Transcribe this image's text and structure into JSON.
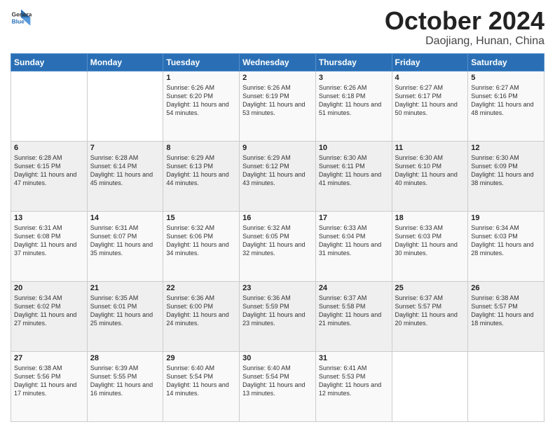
{
  "logo": {
    "general": "General",
    "blue": "Blue"
  },
  "header": {
    "title": "October 2024",
    "subtitle": "Daojiang, Hunan, China"
  },
  "days_of_week": [
    "Sunday",
    "Monday",
    "Tuesday",
    "Wednesday",
    "Thursday",
    "Friday",
    "Saturday"
  ],
  "weeks": [
    [
      {
        "day": "",
        "detail": ""
      },
      {
        "day": "",
        "detail": ""
      },
      {
        "day": "1",
        "detail": "Sunrise: 6:26 AM\nSunset: 6:20 PM\nDaylight: 11 hours and 54 minutes."
      },
      {
        "day": "2",
        "detail": "Sunrise: 6:26 AM\nSunset: 6:19 PM\nDaylight: 11 hours and 53 minutes."
      },
      {
        "day": "3",
        "detail": "Sunrise: 6:26 AM\nSunset: 6:18 PM\nDaylight: 11 hours and 51 minutes."
      },
      {
        "day": "4",
        "detail": "Sunrise: 6:27 AM\nSunset: 6:17 PM\nDaylight: 11 hours and 50 minutes."
      },
      {
        "day": "5",
        "detail": "Sunrise: 6:27 AM\nSunset: 6:16 PM\nDaylight: 11 hours and 48 minutes."
      }
    ],
    [
      {
        "day": "6",
        "detail": "Sunrise: 6:28 AM\nSunset: 6:15 PM\nDaylight: 11 hours and 47 minutes."
      },
      {
        "day": "7",
        "detail": "Sunrise: 6:28 AM\nSunset: 6:14 PM\nDaylight: 11 hours and 45 minutes."
      },
      {
        "day": "8",
        "detail": "Sunrise: 6:29 AM\nSunset: 6:13 PM\nDaylight: 11 hours and 44 minutes."
      },
      {
        "day": "9",
        "detail": "Sunrise: 6:29 AM\nSunset: 6:12 PM\nDaylight: 11 hours and 43 minutes."
      },
      {
        "day": "10",
        "detail": "Sunrise: 6:30 AM\nSunset: 6:11 PM\nDaylight: 11 hours and 41 minutes."
      },
      {
        "day": "11",
        "detail": "Sunrise: 6:30 AM\nSunset: 6:10 PM\nDaylight: 11 hours and 40 minutes."
      },
      {
        "day": "12",
        "detail": "Sunrise: 6:30 AM\nSunset: 6:09 PM\nDaylight: 11 hours and 38 minutes."
      }
    ],
    [
      {
        "day": "13",
        "detail": "Sunrise: 6:31 AM\nSunset: 6:08 PM\nDaylight: 11 hours and 37 minutes."
      },
      {
        "day": "14",
        "detail": "Sunrise: 6:31 AM\nSunset: 6:07 PM\nDaylight: 11 hours and 35 minutes."
      },
      {
        "day": "15",
        "detail": "Sunrise: 6:32 AM\nSunset: 6:06 PM\nDaylight: 11 hours and 34 minutes."
      },
      {
        "day": "16",
        "detail": "Sunrise: 6:32 AM\nSunset: 6:05 PM\nDaylight: 11 hours and 32 minutes."
      },
      {
        "day": "17",
        "detail": "Sunrise: 6:33 AM\nSunset: 6:04 PM\nDaylight: 11 hours and 31 minutes."
      },
      {
        "day": "18",
        "detail": "Sunrise: 6:33 AM\nSunset: 6:03 PM\nDaylight: 11 hours and 30 minutes."
      },
      {
        "day": "19",
        "detail": "Sunrise: 6:34 AM\nSunset: 6:03 PM\nDaylight: 11 hours and 28 minutes."
      }
    ],
    [
      {
        "day": "20",
        "detail": "Sunrise: 6:34 AM\nSunset: 6:02 PM\nDaylight: 11 hours and 27 minutes."
      },
      {
        "day": "21",
        "detail": "Sunrise: 6:35 AM\nSunset: 6:01 PM\nDaylight: 11 hours and 25 minutes."
      },
      {
        "day": "22",
        "detail": "Sunrise: 6:36 AM\nSunset: 6:00 PM\nDaylight: 11 hours and 24 minutes."
      },
      {
        "day": "23",
        "detail": "Sunrise: 6:36 AM\nSunset: 5:59 PM\nDaylight: 11 hours and 23 minutes."
      },
      {
        "day": "24",
        "detail": "Sunrise: 6:37 AM\nSunset: 5:58 PM\nDaylight: 11 hours and 21 minutes."
      },
      {
        "day": "25",
        "detail": "Sunrise: 6:37 AM\nSunset: 5:57 PM\nDaylight: 11 hours and 20 minutes."
      },
      {
        "day": "26",
        "detail": "Sunrise: 6:38 AM\nSunset: 5:57 PM\nDaylight: 11 hours and 18 minutes."
      }
    ],
    [
      {
        "day": "27",
        "detail": "Sunrise: 6:38 AM\nSunset: 5:56 PM\nDaylight: 11 hours and 17 minutes."
      },
      {
        "day": "28",
        "detail": "Sunrise: 6:39 AM\nSunset: 5:55 PM\nDaylight: 11 hours and 16 minutes."
      },
      {
        "day": "29",
        "detail": "Sunrise: 6:40 AM\nSunset: 5:54 PM\nDaylight: 11 hours and 14 minutes."
      },
      {
        "day": "30",
        "detail": "Sunrise: 6:40 AM\nSunset: 5:54 PM\nDaylight: 11 hours and 13 minutes."
      },
      {
        "day": "31",
        "detail": "Sunrise: 6:41 AM\nSunset: 5:53 PM\nDaylight: 11 hours and 12 minutes."
      },
      {
        "day": "",
        "detail": ""
      },
      {
        "day": "",
        "detail": ""
      }
    ]
  ]
}
